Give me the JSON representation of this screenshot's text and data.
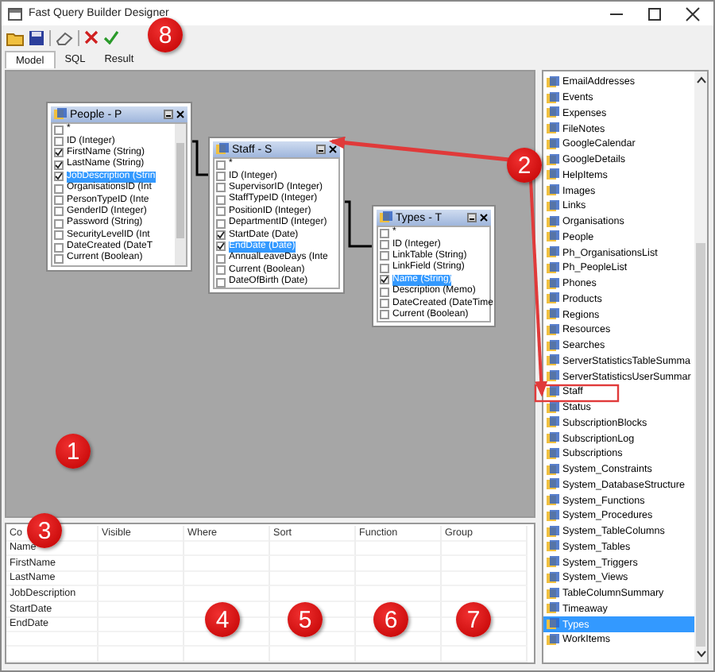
{
  "window": {
    "title": "Fast Query Builder Designer"
  },
  "tabs": [
    {
      "label": "Model",
      "selected": true
    },
    {
      "label": "SQL",
      "selected": false
    },
    {
      "label": "Result",
      "selected": false
    }
  ],
  "tables": [
    {
      "title": "People - P",
      "scrollable": true,
      "fields": [
        {
          "label": "*",
          "checked": false,
          "selected": false
        },
        {
          "label": "ID (Integer)",
          "checked": false,
          "selected": false
        },
        {
          "label": "FirstName (String)",
          "checked": true,
          "selected": false
        },
        {
          "label": "LastName (String)",
          "checked": true,
          "selected": false
        },
        {
          "label": "JobDescription (Strin",
          "checked": true,
          "selected": true
        },
        {
          "label": "OrganisationsID (Int",
          "checked": false,
          "selected": false
        },
        {
          "label": "PersonTypeID (Inte",
          "checked": false,
          "selected": false
        },
        {
          "label": "GenderID (Integer)",
          "checked": false,
          "selected": false
        },
        {
          "label": "Password (String)",
          "checked": false,
          "selected": false
        },
        {
          "label": "SecurityLevelID (Int",
          "checked": false,
          "selected": false
        },
        {
          "label": "DateCreated (DateT",
          "checked": false,
          "selected": false
        },
        {
          "label": "Current (Boolean)",
          "checked": false,
          "selected": false
        }
      ]
    },
    {
      "title": "Staff - S",
      "scrollable": false,
      "fields": [
        {
          "label": "*",
          "checked": false,
          "selected": false
        },
        {
          "label": "ID (Integer)",
          "checked": false,
          "selected": false
        },
        {
          "label": "SupervisorID (Integer)",
          "checked": false,
          "selected": false
        },
        {
          "label": "StaffTypeID (Integer)",
          "checked": false,
          "selected": false
        },
        {
          "label": "PositionID (Integer)",
          "checked": false,
          "selected": false
        },
        {
          "label": "DepartmentID (Integer)",
          "checked": false,
          "selected": false
        },
        {
          "label": "StartDate (Date)",
          "checked": true,
          "selected": false
        },
        {
          "label": "EndDate (Date)",
          "checked": true,
          "selected": true
        },
        {
          "label": "AnnualLeaveDays (Inte",
          "checked": false,
          "selected": false
        },
        {
          "label": "Current (Boolean)",
          "checked": false,
          "selected": false
        },
        {
          "label": "DateOfBirth (Date)",
          "checked": false,
          "selected": false
        }
      ]
    },
    {
      "title": "Types - T",
      "scrollable": false,
      "fields": [
        {
          "label": "*",
          "checked": false,
          "selected": false
        },
        {
          "label": "ID (Integer)",
          "checked": false,
          "selected": false
        },
        {
          "label": "LinkTable (String)",
          "checked": false,
          "selected": false
        },
        {
          "label": "LinkField (String)",
          "checked": false,
          "selected": false
        },
        {
          "label": "Name (String)",
          "checked": true,
          "selected": true
        },
        {
          "label": "Description (Memo)",
          "checked": false,
          "selected": false
        },
        {
          "label": "DateCreated (DateTime",
          "checked": false,
          "selected": false
        },
        {
          "label": "Current (Boolean)",
          "checked": false,
          "selected": false
        }
      ]
    }
  ],
  "object_list": {
    "items": [
      {
        "label": "EmailAddresses",
        "selected": false
      },
      {
        "label": "Events",
        "selected": false
      },
      {
        "label": "Expenses",
        "selected": false
      },
      {
        "label": "FileNotes",
        "selected": false
      },
      {
        "label": "GoogleCalendar",
        "selected": false
      },
      {
        "label": "GoogleDetails",
        "selected": false
      },
      {
        "label": "HelpItems",
        "selected": false
      },
      {
        "label": "Images",
        "selected": false
      },
      {
        "label": "Links",
        "selected": false
      },
      {
        "label": "Organisations",
        "selected": false
      },
      {
        "label": "People",
        "selected": false
      },
      {
        "label": "Ph_OrganisationsList",
        "selected": false
      },
      {
        "label": "Ph_PeopleList",
        "selected": false
      },
      {
        "label": "Phones",
        "selected": false
      },
      {
        "label": "Products",
        "selected": false
      },
      {
        "label": "Regions",
        "selected": false
      },
      {
        "label": "Resources",
        "selected": false
      },
      {
        "label": "Searches",
        "selected": false
      },
      {
        "label": "ServerStatisticsTableSumma",
        "selected": false
      },
      {
        "label": "ServerStatisticsUserSummar",
        "selected": false
      },
      {
        "label": "Staff",
        "selected": false
      },
      {
        "label": "Status",
        "selected": false
      },
      {
        "label": "SubscriptionBlocks",
        "selected": false
      },
      {
        "label": "SubscriptionLog",
        "selected": false
      },
      {
        "label": "Subscriptions",
        "selected": false
      },
      {
        "label": "System_Constraints",
        "selected": false
      },
      {
        "label": "System_DatabaseStructure",
        "selected": false
      },
      {
        "label": "System_Functions",
        "selected": false
      },
      {
        "label": "System_Procedures",
        "selected": false
      },
      {
        "label": "System_TableColumns",
        "selected": false
      },
      {
        "label": "System_Tables",
        "selected": false
      },
      {
        "label": "System_Triggers",
        "selected": false
      },
      {
        "label": "System_Views",
        "selected": false
      },
      {
        "label": "TableColumnSummary",
        "selected": false
      },
      {
        "label": "Timeaway",
        "selected": false
      },
      {
        "label": "Types",
        "selected": true
      },
      {
        "label": "WorkItems",
        "selected": false
      }
    ]
  },
  "grid": {
    "columns": [
      "Co",
      "Visible",
      "Where",
      "Sort",
      "Function",
      "Group"
    ],
    "rows": [
      "Name",
      "FirstName",
      "LastName",
      "JobDescription",
      "StartDate",
      "EndDate"
    ]
  },
  "callouts": [
    "1",
    "2",
    "3",
    "4",
    "5",
    "6",
    "7",
    "8"
  ]
}
